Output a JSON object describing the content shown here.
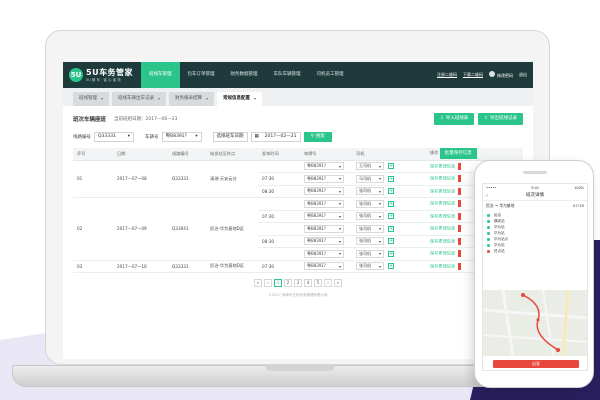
{
  "header": {
    "logo_mark": "5U",
    "logo_name": "5U车务管家",
    "logo_sub": "5U 管 车 · 省 心 省 钱",
    "nav": [
      "班线车管理",
      "包车订单管理",
      "财务数据管理",
      "车队车辆管理",
      "司机员工管理"
    ],
    "right_links": [
      "注册二维码",
      "下载二维码"
    ],
    "user_label": "修改密码",
    "logout": "退出"
  },
  "tabs": [
    {
      "label": "班线管理"
    },
    {
      "label": "班线车辆出车记录"
    },
    {
      "label": "财务报表结算"
    },
    {
      "label": "常规信息配置"
    }
  ],
  "panel": {
    "title": "班次车辆座班",
    "date_label": "当前班组日期：2017—06—23",
    "import_btn": "导入班线表",
    "export_btn": "导出班线记录"
  },
  "filters": {
    "route_label": "线路编号",
    "route_value": "Q33331",
    "plate_label": "车辆号",
    "plate_value": "粤B8391?",
    "date_label": "选择班车日期",
    "date_value": "2017—02—21",
    "query_btn": "搜索"
  },
  "table": {
    "headers": [
      "序号",
      "日期",
      "线路编号",
      "始发站至终点",
      "发车时间",
      "车牌号",
      "司机",
      "操作"
    ],
    "batch_btn": "批量保存信息",
    "groups": [
      {
        "no": "01",
        "date": "2017—07—08",
        "route": "Q33331",
        "stops": "清湖-天安云谷",
        "rows": [
          {
            "time": "",
            "plate": "粤B8391?",
            "driver": "王司机",
            "op": "保存更改信息"
          },
          {
            "time": "07:30",
            "plate": "粤B8391?",
            "driver": "马司机",
            "op": "保存更改信息"
          },
          {
            "time": "08:30",
            "plate": "粤B8391?",
            "driver": "张司机",
            "op": "保存更改信息"
          }
        ]
      },
      {
        "no": "02",
        "date": "2017—07—09",
        "route": "Q33041",
        "stops": "民治-华为基地D区",
        "rows": [
          {
            "time": "",
            "plate": "粤B8391?",
            "driver": "张司机",
            "op": "保存更改信息"
          },
          {
            "time": "07:30",
            "plate": "粤B8391?",
            "driver": "张司机",
            "op": "保存更改信息"
          },
          {
            "time": "",
            "plate": "粤B8391?",
            "driver": "张司机",
            "op": "保存更改信息"
          },
          {
            "time": "08:30",
            "plate": "粤B8391?",
            "driver": "张司机",
            "op": "保存更改信息"
          },
          {
            "time": "",
            "plate": "粤B8391?",
            "driver": "张司机",
            "op": "保存更改信息"
          }
        ]
      },
      {
        "no": "03",
        "date": "2017—07—10",
        "route": "Q33331",
        "stops": "民治-华为基地D区",
        "rows": [
          {
            "time": "07:30",
            "plate": "粤B8391?",
            "driver": "张司机",
            "op": "保存更改信息"
          }
        ]
      }
    ]
  },
  "pager": [
    "«",
    "‹",
    "1",
    "2",
    "3",
    "4",
    "5",
    "›",
    "»"
  ],
  "pager_active": "1",
  "footer": "©2017 深圳市五优车务管理有限公司",
  "phone": {
    "time": "9:41",
    "carrier": "•••••",
    "battery": "100%",
    "title": "班次详情",
    "route_head": "民治 → 华为基地",
    "route_meta": "07:30",
    "stops": [
      "民治",
      "横岗站",
      "华为站",
      "华为站",
      "华为站点",
      "华为站",
      "终点站"
    ],
    "button": "出发"
  },
  "colors": {
    "accent": "#2bc48a",
    "header": "#1e3a3b",
    "alert": "#e8473d"
  }
}
